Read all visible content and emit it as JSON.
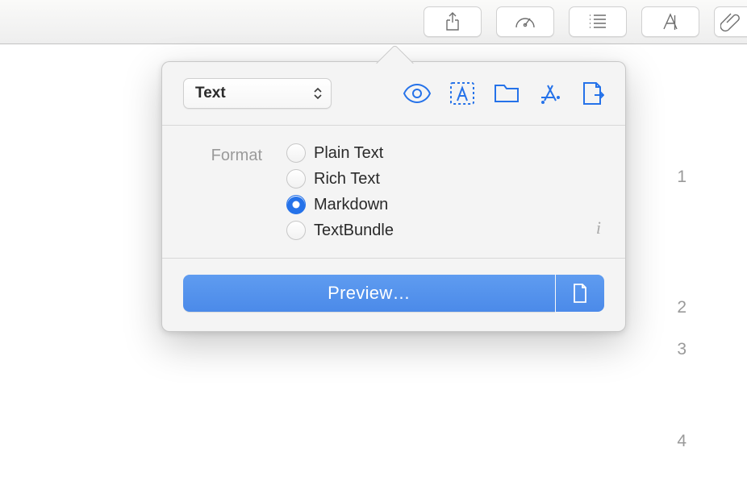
{
  "toolbar": {
    "items": [
      {
        "name": "share-button",
        "icon": "share-icon"
      },
      {
        "name": "dashboard-button",
        "icon": "gauge-icon"
      },
      {
        "name": "outline-button",
        "icon": "list-icon"
      },
      {
        "name": "appearance-button",
        "icon": "letter-a-icon"
      },
      {
        "name": "attach-button",
        "icon": "paperclip-icon"
      }
    ]
  },
  "popover": {
    "dropdown": {
      "selected": "Text"
    },
    "mode_icons": [
      "eye-icon",
      "text-selection-icon",
      "folder-icon",
      "app-store-icon",
      "export-icon"
    ],
    "format": {
      "label": "Format",
      "options": [
        {
          "label": "Plain Text",
          "selected": false
        },
        {
          "label": "Rich Text",
          "selected": false
        },
        {
          "label": "Markdown",
          "selected": true
        },
        {
          "label": "TextBundle",
          "selected": false
        }
      ],
      "info_hint": "i"
    },
    "action": {
      "primary_label": "Preview…"
    }
  },
  "page_numbers": [
    "1",
    "2",
    "3",
    "4"
  ]
}
